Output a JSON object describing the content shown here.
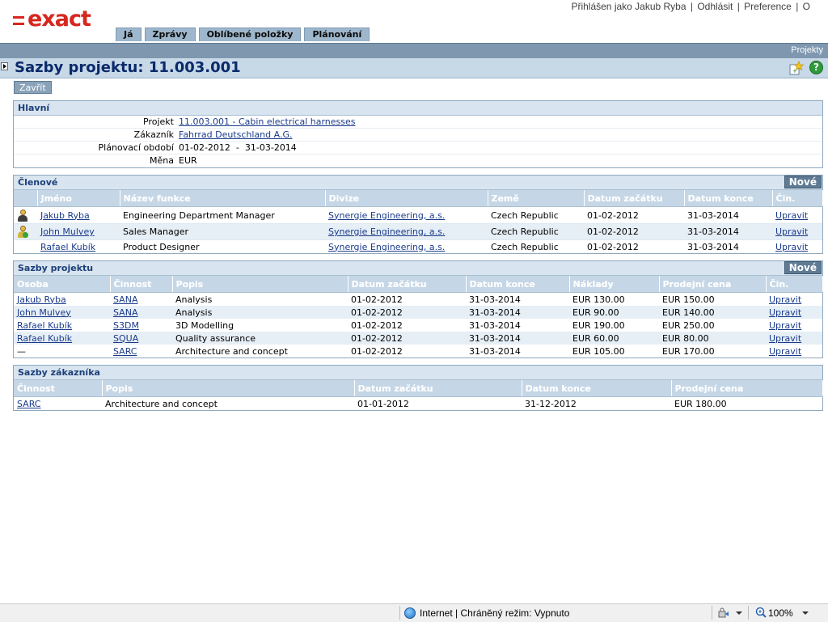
{
  "brand": {
    "logo_text": "exact",
    "accent": "#d7261e"
  },
  "userbar": {
    "logged_in": "Přihlášen jako Jakub Ryba",
    "logout": "Odhlásit",
    "preferences": "Preference",
    "more": "O"
  },
  "topnav": [
    "Já",
    "Zprávy",
    "Oblíbené položky",
    "Plánování"
  ],
  "breadcrumb": "Projekty",
  "page": {
    "title": "Sazby projektu: 11.003.001",
    "close_label": "Zavřít"
  },
  "main": {
    "title": "Hlavní",
    "fields": [
      {
        "label": "Projekt",
        "value": "11.003.001 - Cabin electrical harnesses",
        "link": true
      },
      {
        "label": "Zákazník",
        "value": "Fahrrad Deutschland A.G.",
        "link": true
      },
      {
        "label": "Plánovací období",
        "value": "01-02-2012  -  31-03-2014",
        "link": false
      },
      {
        "label": "Měna",
        "value": "EUR",
        "link": false
      }
    ]
  },
  "members": {
    "title": "Členové",
    "new_label": "Nové",
    "headers": [
      "Jméno",
      "Název funkce",
      "Divize",
      "Země",
      "Datum začátku",
      "Datum konce",
      "Čin."
    ],
    "rows": [
      {
        "icon": "manager-person-icon",
        "name": "Jakub Ryba",
        "function": "Engineering Department Manager",
        "division": "Synergie Engineering, a.s.",
        "country": "Czech Republic",
        "start": "01-02-2012",
        "end": "31-03-2014",
        "action": "Upravit"
      },
      {
        "icon": "member-person-icon",
        "name": "John Mulvey",
        "function": "Sales Manager",
        "division": "Synergie Engineering, a.s.",
        "country": "Czech Republic",
        "start": "01-02-2012",
        "end": "31-03-2014",
        "action": "Upravit"
      },
      {
        "icon": "",
        "name": "Rafael Kubík",
        "function": "Product Designer",
        "division": "Synergie Engineering, a.s.",
        "country": "Czech Republic",
        "start": "01-02-2012",
        "end": "31-03-2014",
        "action": "Upravit"
      }
    ]
  },
  "project_rates": {
    "title": "Sazby projektu",
    "new_label": "Nové",
    "headers": [
      "Osoba",
      "Činnost",
      "Popis",
      "Datum začátku",
      "Datum konce",
      "Náklady",
      "Prodejní cena",
      "Čin."
    ],
    "rows": [
      {
        "person": "Jakub Ryba",
        "activity": "SANA",
        "description": "Analysis",
        "start": "01-02-2012",
        "end": "31-03-2014",
        "cost": "EUR 130.00",
        "price": "EUR 150.00",
        "action": "Upravit"
      },
      {
        "person": "John Mulvey",
        "activity": "SANA",
        "description": "Analysis",
        "start": "01-02-2012",
        "end": "31-03-2014",
        "cost": "EUR 90.00",
        "price": "EUR 140.00",
        "action": "Upravit"
      },
      {
        "person": "Rafael Kubík",
        "activity": "S3DM",
        "description": "3D Modelling",
        "start": "01-02-2012",
        "end": "31-03-2014",
        "cost": "EUR 190.00",
        "price": "EUR 250.00",
        "action": "Upravit"
      },
      {
        "person": "Rafael Kubík",
        "activity": "SQUA",
        "description": "Quality assurance",
        "start": "01-02-2012",
        "end": "31-03-2014",
        "cost": "EUR 60.00",
        "price": "EUR 80.00",
        "action": "Upravit"
      },
      {
        "person": "—",
        "activity": "SARC",
        "description": "Architecture and concept",
        "start": "01-02-2012",
        "end": "31-03-2014",
        "cost": "EUR 105.00",
        "price": "EUR 170.00",
        "action": "Upravit"
      }
    ]
  },
  "customer_rates": {
    "title": "Sazby zákazníka",
    "headers": [
      "Činnost",
      "Popis",
      "Datum začátku",
      "Datum konce",
      "Prodejní cena"
    ],
    "rows": [
      {
        "activity": "SARC",
        "description": "Architecture and concept",
        "start": "01-01-2012",
        "end": "31-12-2012",
        "price": "EUR 180.00"
      }
    ]
  },
  "statusbar": {
    "zone": "Internet | Chráněný režim: Vypnuto",
    "zoom": "100%"
  }
}
